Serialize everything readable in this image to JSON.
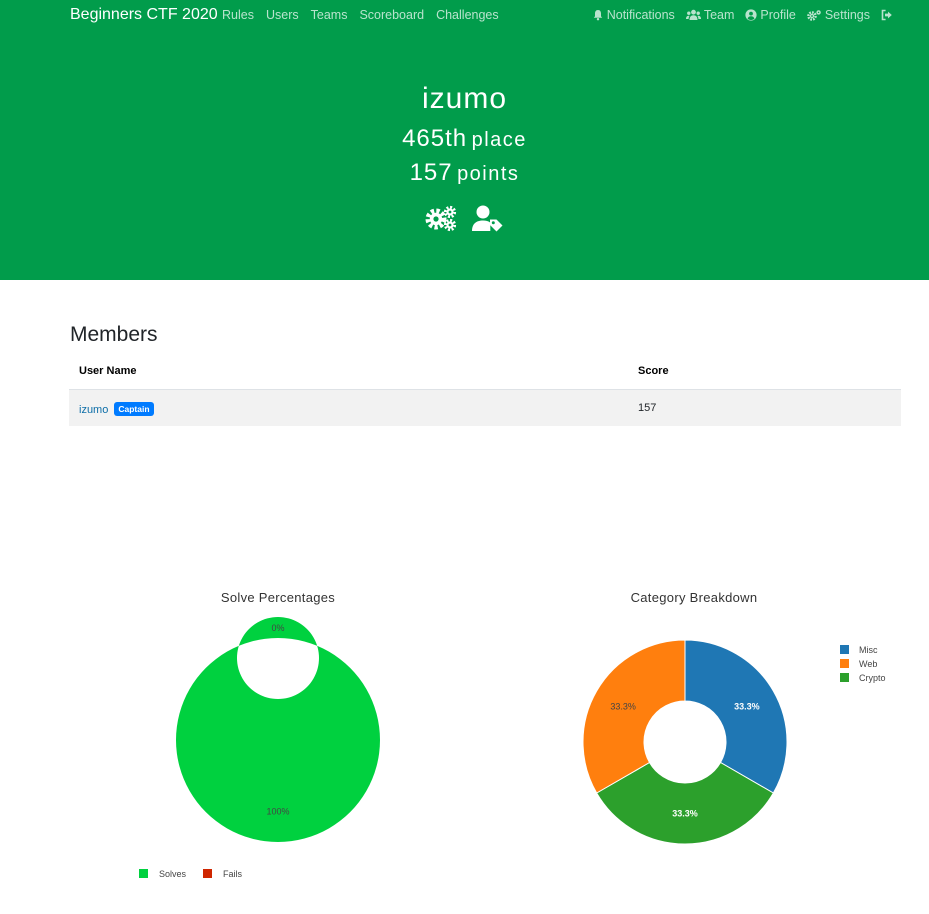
{
  "navbar": {
    "brand": "Beginners CTF 2020",
    "left_links": [
      "Rules",
      "Users",
      "Teams",
      "Scoreboard",
      "Challenges"
    ],
    "right_links": [
      {
        "label": "Notifications",
        "icon": "bell-icon"
      },
      {
        "label": "Team",
        "icon": "users-icon"
      },
      {
        "label": "Profile",
        "icon": "user-circle-icon"
      },
      {
        "label": "Settings",
        "icon": "cogs-icon"
      }
    ],
    "logout_icon": "sign-out-icon"
  },
  "team": {
    "name": "izumo",
    "place_number": "465th",
    "place_word": "place",
    "points_number": "157",
    "points_word": "points",
    "actions": [
      "team-settings-icon",
      "captain-tag-icon"
    ]
  },
  "colors": {
    "hero_bg": "#019c4b",
    "solves": "#00d13f",
    "fails": "#cf2600",
    "misc": "#1f77b4",
    "web": "#ff7f0e",
    "crypto": "#2ca02c",
    "badge": "#007bff"
  },
  "members": {
    "title": "Members",
    "columns": [
      "User Name",
      "Score"
    ],
    "rows": [
      {
        "user": "izumo",
        "badge": "Captain",
        "score": "157"
      }
    ]
  },
  "chart_data": [
    {
      "type": "pie",
      "title": "Solve Percentages",
      "labels": [
        "Solves",
        "Fails"
      ],
      "values": [
        100,
        0
      ],
      "text_labels": [
        "100%",
        "0%"
      ],
      "hole": true,
      "legend_position": "bottom"
    },
    {
      "type": "pie",
      "title": "Category Breakdown",
      "labels": [
        "Misc",
        "Web",
        "Crypto"
      ],
      "values": [
        33.3,
        33.3,
        33.3
      ],
      "text_labels": [
        "33.3%",
        "33.3%",
        "33.3%"
      ],
      "hole": true,
      "legend_position": "right"
    }
  ]
}
